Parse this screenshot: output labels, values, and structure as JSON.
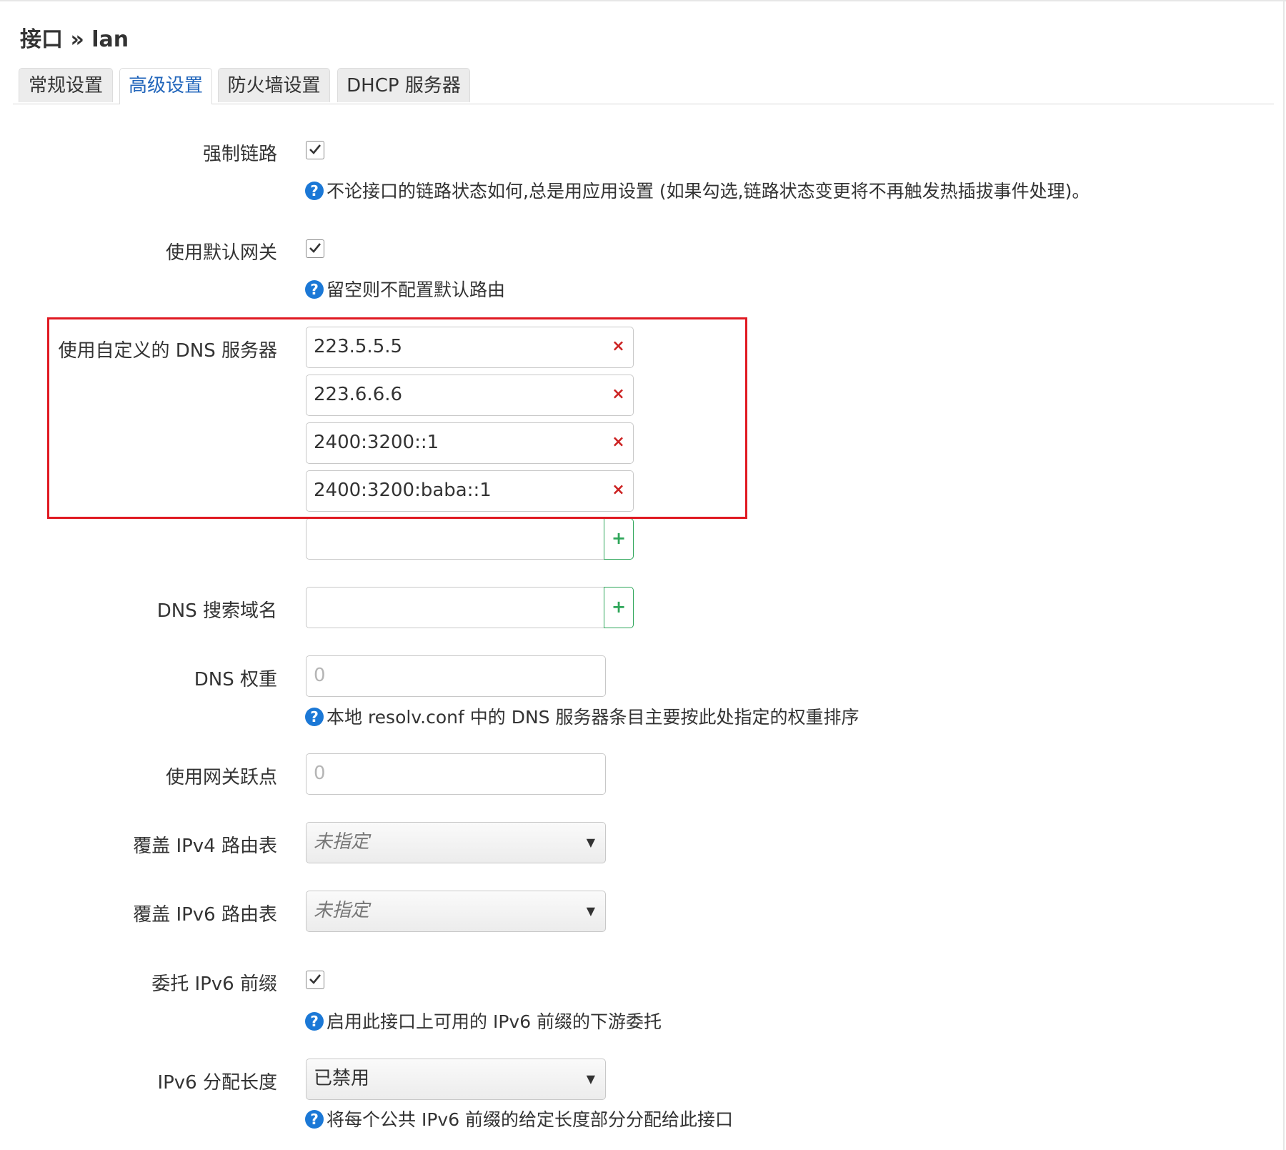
{
  "page": {
    "title": "接口 » lan"
  },
  "tabs": [
    {
      "label": "常规设置",
      "active": false
    },
    {
      "label": "高级设置",
      "active": true
    },
    {
      "label": "防火墙设置",
      "active": false
    },
    {
      "label": "DHCP 服务器",
      "active": false
    }
  ],
  "fields": {
    "force_link": {
      "label": "强制链路",
      "checked": true,
      "help": "不论接口的链路状态如何,总是用应用设置 (如果勾选,链路状态变更将不再触发热插拔事件处理)。"
    },
    "default_gateway": {
      "label": "使用默认网关",
      "checked": true,
      "help": "留空则不配置默认路由"
    },
    "custom_dns": {
      "label": "使用自定义的 DNS 服务器",
      "values": [
        "223.5.5.5",
        "223.6.6.6",
        "2400:3200::1",
        "2400:3200:baba::1"
      ],
      "new_value": ""
    },
    "dns_search": {
      "label": "DNS 搜索域名",
      "value": ""
    },
    "dns_weight": {
      "label": "DNS 权重",
      "placeholder": "0",
      "help": "本地 resolv.conf 中的 DNS 服务器条目主要按此处指定的权重排序"
    },
    "gateway_metric": {
      "label": "使用网关跃点",
      "placeholder": "0"
    },
    "ipv4_table": {
      "label": "覆盖 IPv4 路由表",
      "selected": "未指定"
    },
    "ipv6_table": {
      "label": "覆盖 IPv6 路由表",
      "selected": "未指定"
    },
    "delegate": {
      "label": "委托 IPv6 前缀",
      "checked": true,
      "help": "启用此接口上可用的 IPv6 前缀的下游委托"
    },
    "ip6assign": {
      "label": "IPv6 分配长度",
      "selected": "已禁用",
      "help": "将每个公共 IPv6 前缀的给定长度部分分配给此接口"
    }
  },
  "icons": {
    "help": "question-circle-icon",
    "remove": "remove-x-icon",
    "add": "add-plus-icon",
    "caret": "caret-down-icon",
    "check": "checkmark-icon"
  },
  "symbols": {
    "help": "?",
    "remove": "×",
    "add": "+",
    "caret": "▼"
  },
  "colors": {
    "active_tab_text": "#2266bb",
    "help_icon": "#1b78d6",
    "remove_button": "#cc2222",
    "add_button": "#2fa65a",
    "annotation_box": "#e01a22"
  }
}
